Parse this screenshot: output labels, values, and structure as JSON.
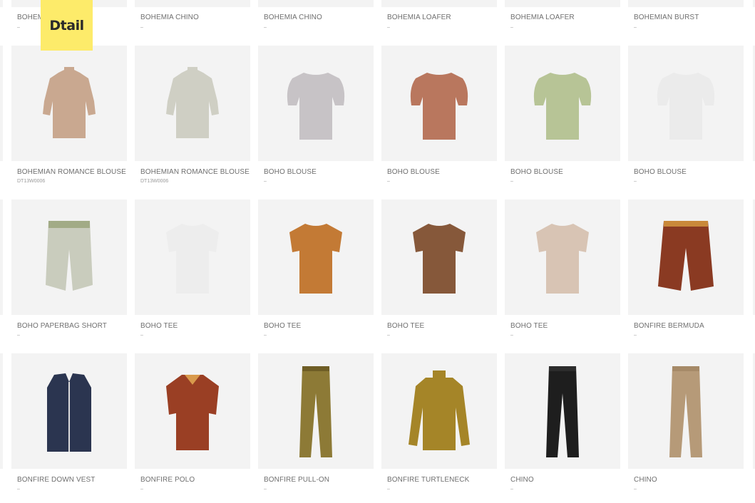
{
  "brand": {
    "logo_text": "Dtail",
    "logo_color": "#fdeb6a"
  },
  "top_row": [
    {
      "name": "BOHEMIA CHINO",
      "sub": "–"
    },
    {
      "name": "BOHEMIA CHINO",
      "sub": "–"
    },
    {
      "name": "BOHEMIA CHINO",
      "sub": "–"
    },
    {
      "name": "BOHEMIA LOAFER",
      "sub": "–"
    },
    {
      "name": "BOHEMIA LOAFER",
      "sub": "–"
    },
    {
      "name": "BOHEMIAN BURST",
      "sub": "–"
    }
  ],
  "products": [
    {
      "name": "BOHEMIAN ROMANCE BLOUSE",
      "sub": "DT13W0006",
      "icon": "blouse-icon",
      "color": "#c9a890",
      "pattern": "#9a6f5a"
    },
    {
      "name": "BOHEMIAN ROMANCE BLOUSE",
      "sub": "DT13W0006",
      "icon": "blouse-icon",
      "color": "#cfcfc4",
      "pattern": "#8e9385"
    },
    {
      "name": "BOHO BLOUSE",
      "sub": "–",
      "icon": "puff-sleeve-top-icon",
      "color": "#c7c3c6",
      "pattern": "#a7a1a4"
    },
    {
      "name": "BOHO BLOUSE",
      "sub": "–",
      "icon": "puff-sleeve-top-icon",
      "color": "#b9775e",
      "pattern": "#a86750"
    },
    {
      "name": "BOHO BLOUSE",
      "sub": "–",
      "icon": "puff-sleeve-top-icon",
      "color": "#b7c496",
      "pattern": "#a7b486"
    },
    {
      "name": "BOHO BLOUSE",
      "sub": "–",
      "icon": "puff-sleeve-top-icon",
      "color": "#ebebeb",
      "pattern": "#d8d8d8"
    },
    {
      "name": "BOHO PAPERBAG SHORT",
      "sub": "–",
      "icon": "shorts-icon",
      "color": "#c9ccbd",
      "pattern": "#a2ab86"
    },
    {
      "name": "BOHO TEE",
      "sub": "–",
      "icon": "tee-icon",
      "color": "#ededed",
      "pattern": "#dcdcdc"
    },
    {
      "name": "BOHO TEE",
      "sub": "–",
      "icon": "tee-icon",
      "color": "#c37a35",
      "pattern": "#b36c2a"
    },
    {
      "name": "BOHO TEE",
      "sub": "–",
      "icon": "tee-icon",
      "color": "#86583a",
      "pattern": "#784c30"
    },
    {
      "name": "BOHO TEE",
      "sub": "–",
      "icon": "tee-icon",
      "color": "#d8c4b4",
      "pattern": "#a98a78"
    },
    {
      "name": "BONFIRE BERMUDA",
      "sub": "–",
      "icon": "bermuda-shorts-icon",
      "color": "#8a3a22",
      "pattern": "#c9893a"
    },
    {
      "name": "BONFIRE DOWN VEST",
      "sub": "–",
      "icon": "vest-icon",
      "color": "#2b3550",
      "pattern": "#c2612d"
    },
    {
      "name": "BONFIRE POLO",
      "sub": "–",
      "icon": "polo-icon",
      "color": "#9a3f24",
      "pattern": "#d99a4c"
    },
    {
      "name": "BONFIRE PULL-ON",
      "sub": "–",
      "icon": "pants-icon",
      "color": "#8d7a36",
      "pattern": "#6f5e26"
    },
    {
      "name": "BONFIRE TURTLENECK",
      "sub": "–",
      "icon": "turtleneck-icon",
      "color": "#a58528",
      "pattern": "#7a6020"
    },
    {
      "name": "CHINO",
      "sub": "–",
      "icon": "pants-icon",
      "color": "#1e1e1e",
      "pattern": "#2c2c2c"
    },
    {
      "name": "CHINO",
      "sub": "–",
      "icon": "pants-icon",
      "color": "#b69a78",
      "pattern": "#a68a68"
    }
  ]
}
